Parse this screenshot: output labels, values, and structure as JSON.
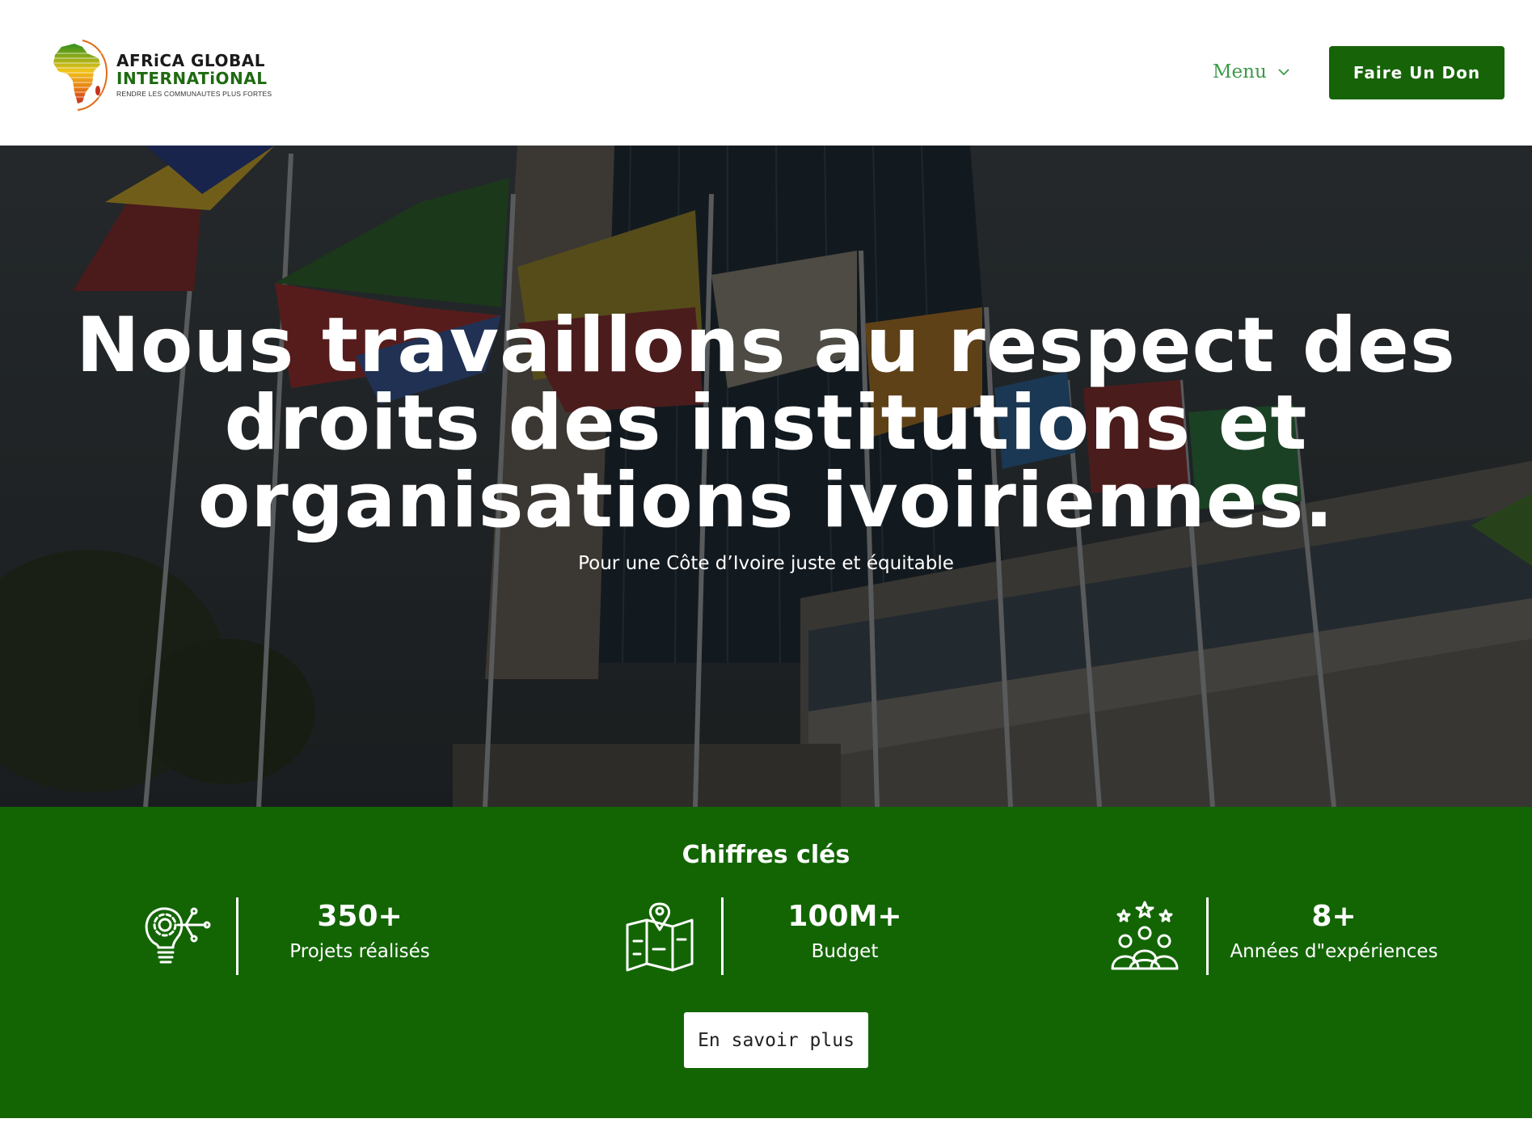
{
  "header": {
    "logo": {
      "line1": "AFRiCA GLOBAL",
      "line2": "INTERNATiONAL",
      "tagline": "RENDRE LES COMMUNAUTES PLUS FORTES"
    },
    "menu_label": "Menu",
    "donate_label": "Faire Un Don"
  },
  "hero": {
    "title_lines": [
      "Nous travaillons au respect des",
      "droits des institutions et",
      "organisations ivoiriennes."
    ],
    "subtitle": "Pour une Côte d’Ivoire juste et équitable"
  },
  "stats": {
    "title": "Chiffres clés",
    "items": [
      {
        "icon": "lightbulb-gear-icon",
        "value": "350+",
        "label": "Projets réalisés"
      },
      {
        "icon": "map-pin-icon",
        "value": "100M+",
        "label": "Budget"
      },
      {
        "icon": "team-stars-icon",
        "value": "8+",
        "label": "Années d\"expériences"
      }
    ],
    "button_label": "En savoir plus"
  },
  "colors": {
    "brand_green": "#176308",
    "stats_bg": "#136504",
    "menu_text": "#3d9a48"
  }
}
